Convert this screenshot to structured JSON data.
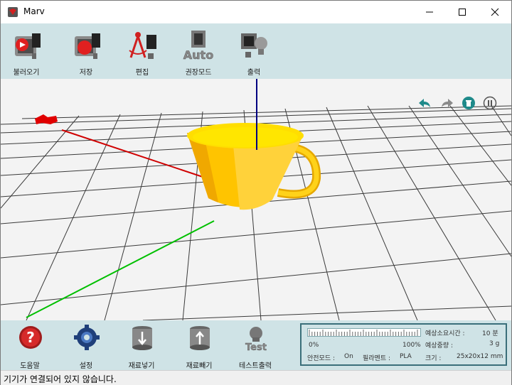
{
  "window": {
    "title": "Marv"
  },
  "toolbar": {
    "items": [
      {
        "label": "불러오기"
      },
      {
        "label": "저장"
      },
      {
        "label": "편집"
      },
      {
        "label": "권장모드"
      },
      {
        "label": "출력"
      }
    ]
  },
  "bottom": {
    "items": [
      {
        "label": "도움말"
      },
      {
        "label": "설정"
      },
      {
        "label": "재료넣기"
      },
      {
        "label": "재료빼기"
      },
      {
        "label": "테스트출력"
      }
    ]
  },
  "info": {
    "progress": {
      "value": 0,
      "min_label": "0%",
      "max_label": "100%"
    },
    "safe_mode_label": "안전모드 :",
    "safe_mode_value": "On",
    "filament_label": "필라멘트 :",
    "filament_value": "PLA",
    "time_label": "예상소요시간 :",
    "time_value": "10 분",
    "weight_label": "예상중량 :",
    "weight_value": "3 g",
    "size_label": "크기 :",
    "size_value": "25x20x12 mm"
  },
  "status": {
    "text": "기기가 연결되어 있지 않습니다."
  },
  "colors": {
    "toolbar_bg": "#cfe3e6",
    "viewport_bg": "#f3f3f3",
    "model": "#ffc107",
    "x_axis": "#d00000",
    "y_axis": "#00c000",
    "z_axis": "#000080"
  }
}
